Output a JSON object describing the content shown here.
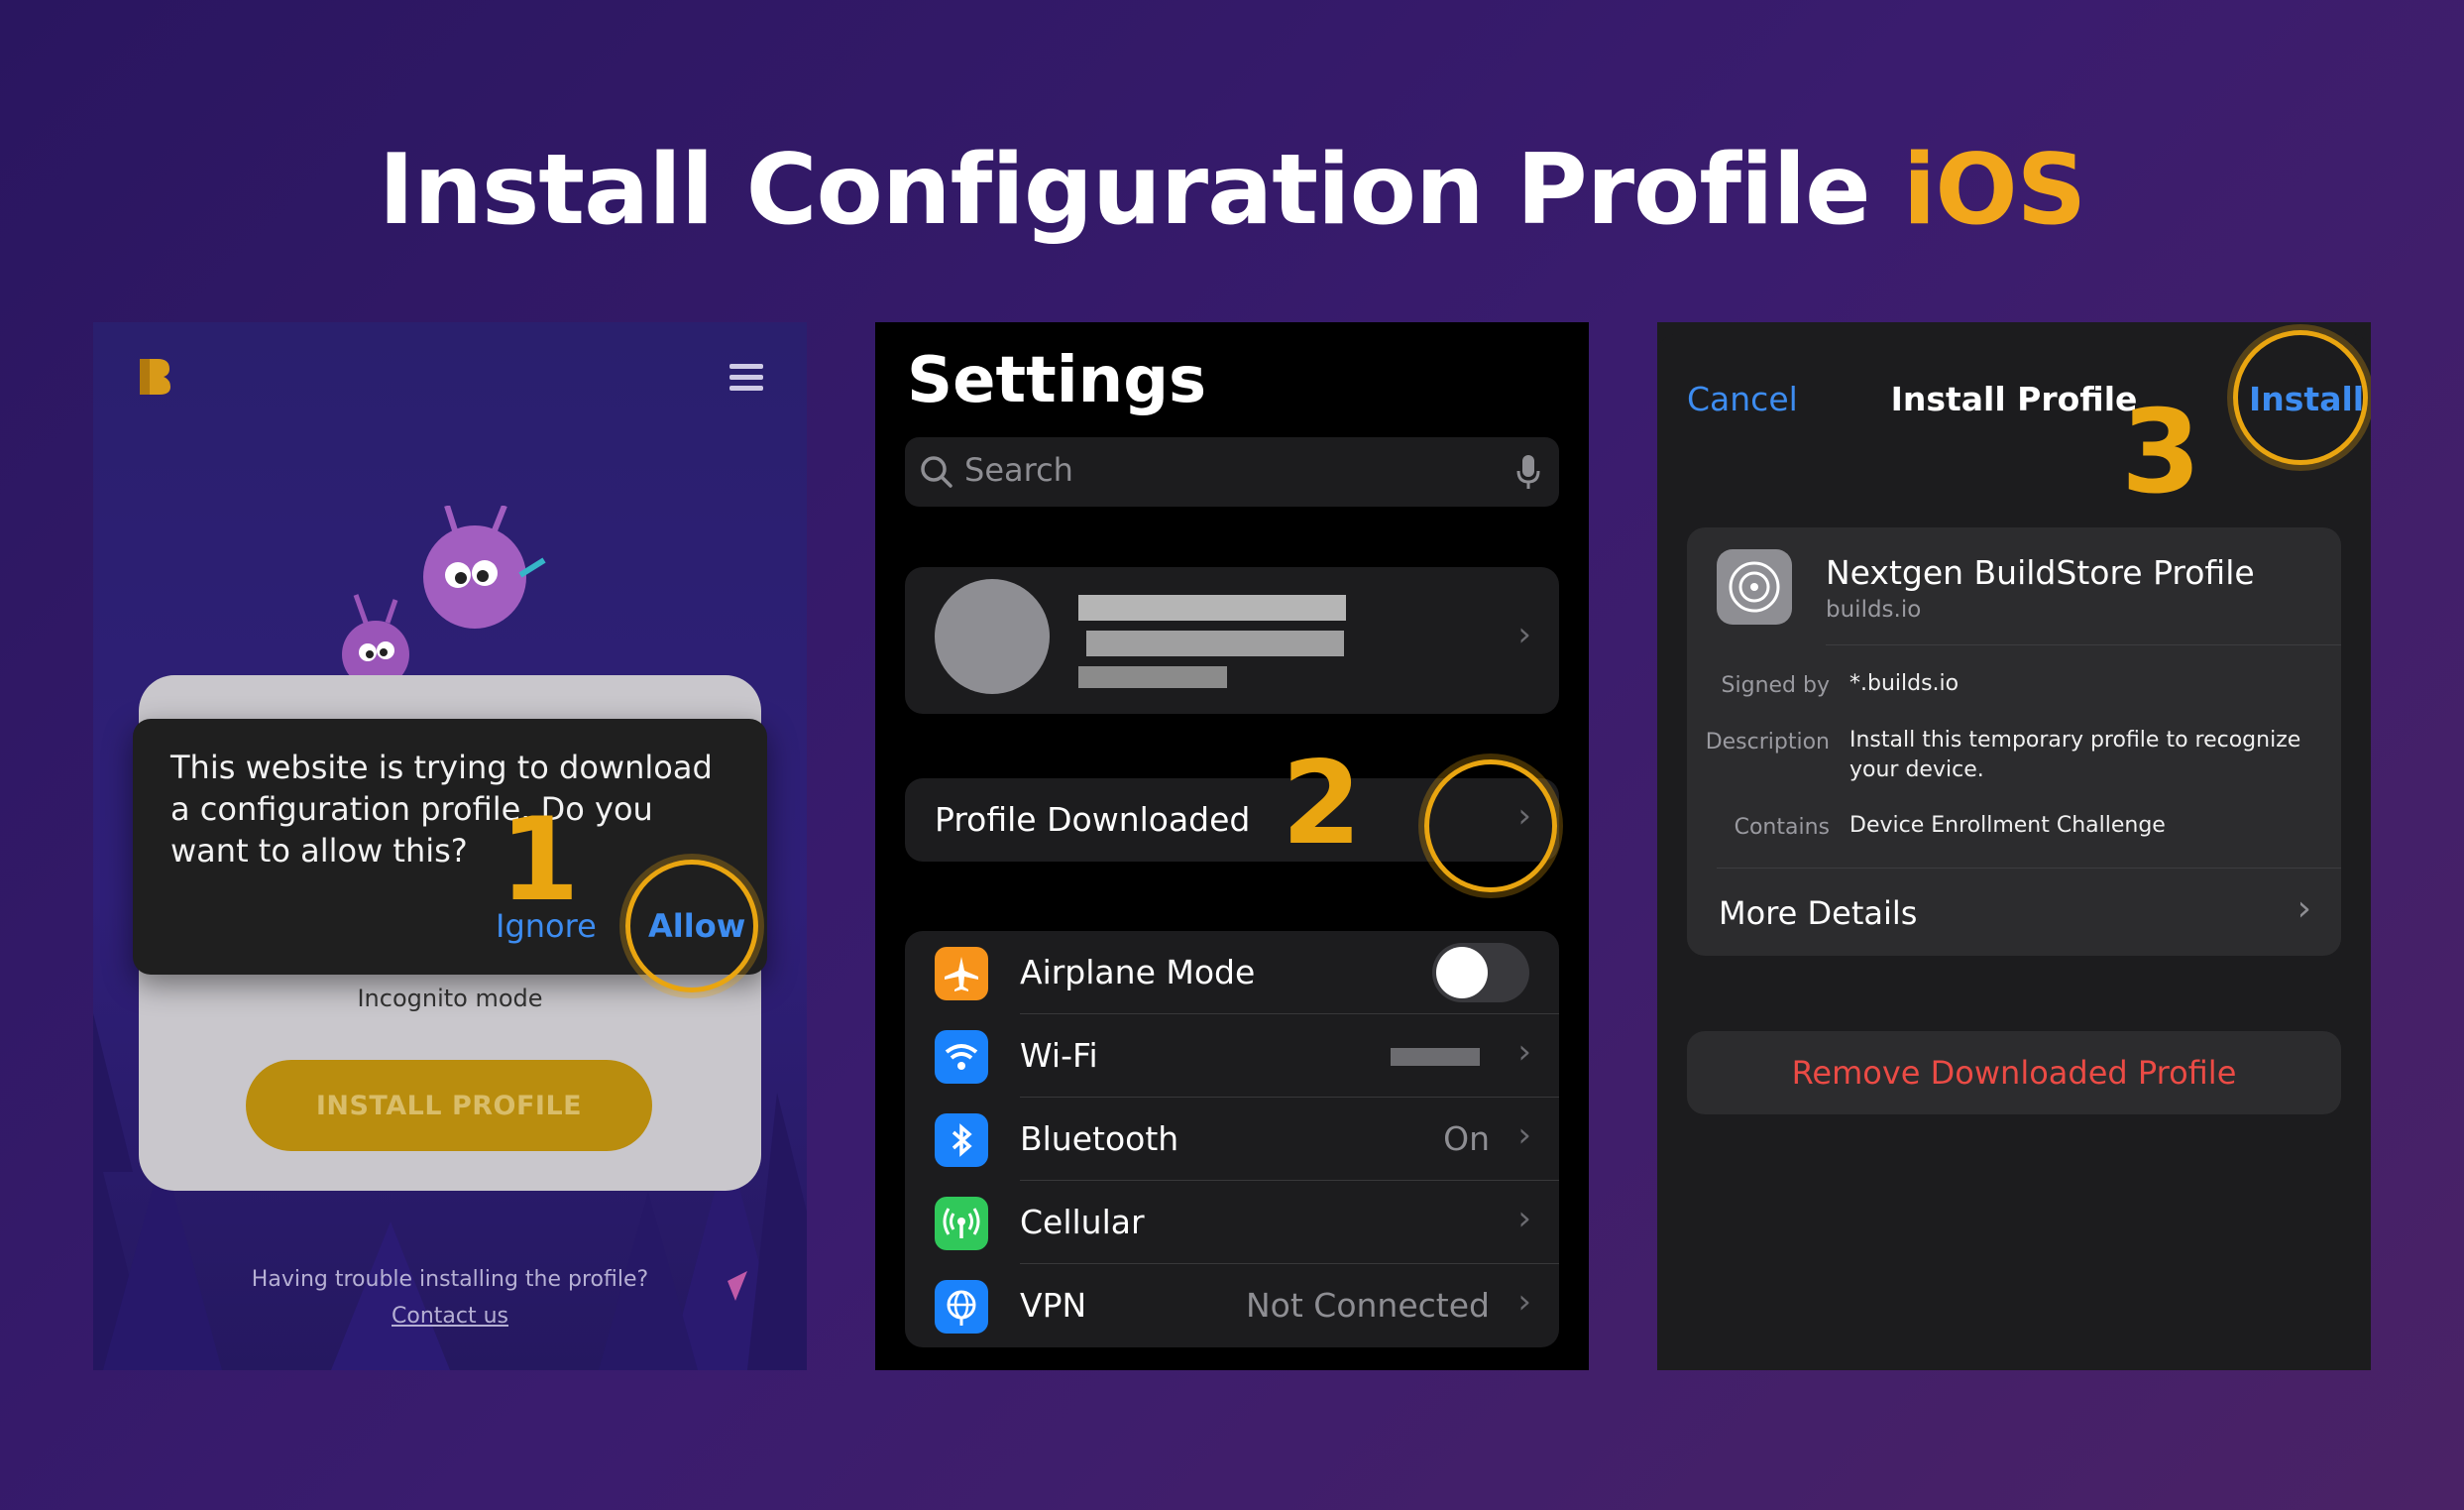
{
  "title": {
    "main": "Install Configuration Profile",
    "accent": "iOS"
  },
  "step1": {
    "number": "1",
    "dialog_message": "This website is trying to download a configuration profile. Do you want to allow this?",
    "ignore_label": "Ignore",
    "allow_label": "Allow",
    "incognito_label": "Incognito mode",
    "install_button_label": "INSTALL PROFILE",
    "trouble_text": "Having trouble installing the profile?",
    "contact_link": "Contact us"
  },
  "step2": {
    "number": "2",
    "header": "Settings",
    "search_placeholder": "Search",
    "profile_downloaded_label": "Profile Downloaded",
    "rows": [
      {
        "label": "Airplane Mode",
        "value": "",
        "icon": "airplane-icon",
        "color": "#f7931a"
      },
      {
        "label": "Wi-Fi",
        "value": "",
        "icon": "wifi-icon",
        "color": "#1a82fb"
      },
      {
        "label": "Bluetooth",
        "value": "On",
        "icon": "bluetooth-icon",
        "color": "#1a82fb"
      },
      {
        "label": "Cellular",
        "value": "",
        "icon": "cellular-icon",
        "color": "#30c85a"
      },
      {
        "label": "VPN",
        "value": "Not Connected",
        "icon": "globe-icon",
        "color": "#1a82fb"
      }
    ]
  },
  "step3": {
    "number": "3",
    "cancel_label": "Cancel",
    "nav_title": "Install Profile",
    "install_label": "Install",
    "profile_name": "Nextgen BuildStore Profile",
    "profile_domain": "builds.io",
    "signed_by_key": "Signed by",
    "signed_by_value": "*.builds.io",
    "description_key": "Description",
    "description_value": "Install this temporary profile to recognize your device.",
    "contains_key": "Contains",
    "contains_value": "Device Enrollment Challenge",
    "more_details_label": "More Details",
    "remove_label": "Remove Downloaded Profile"
  },
  "colors": {
    "accent": "#f2a71b",
    "ios_blue": "#3d8cf0",
    "destructive": "#eb4b45"
  }
}
